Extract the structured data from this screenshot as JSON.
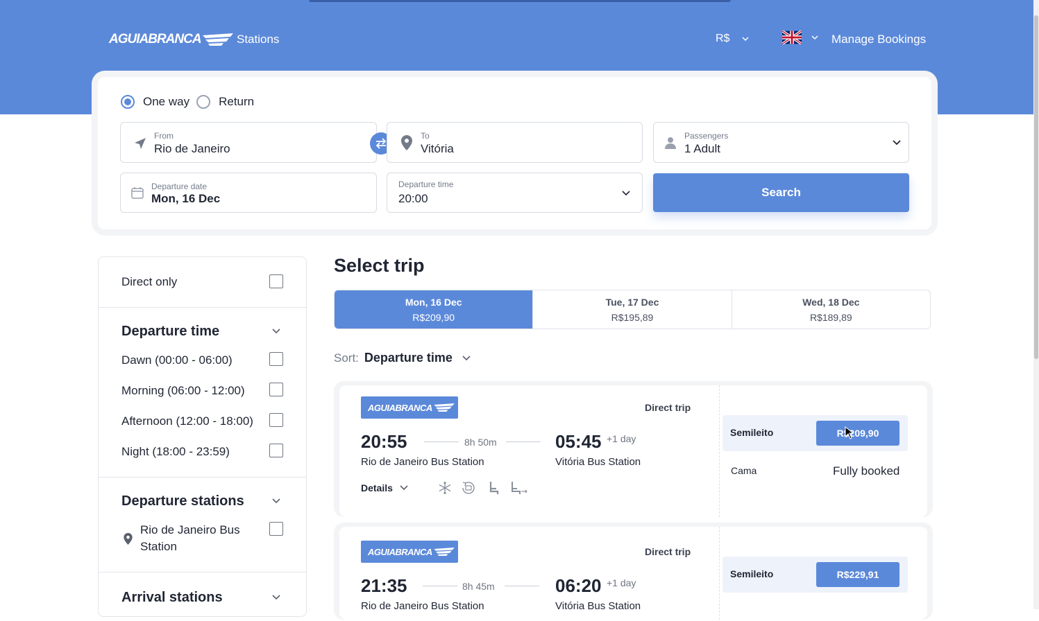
{
  "header": {
    "logo_text": "AGUIABRANCA",
    "stations_link": "Stations",
    "currency": "R$",
    "language_flag": "uk-flag-icon",
    "manage_bookings": "Manage Bookings"
  },
  "search": {
    "trip_types": [
      {
        "label": "One way",
        "selected": true
      },
      {
        "label": "Return",
        "selected": false
      }
    ],
    "from": {
      "label": "From",
      "value": "Rio de Janeiro"
    },
    "to": {
      "label": "To",
      "value": "Vitória"
    },
    "passengers": {
      "label": "Passengers",
      "value": "1 Adult"
    },
    "departure_date": {
      "label": "Departure date",
      "value": "Mon, 16 Dec"
    },
    "departure_time": {
      "label": "Departure time",
      "value": "20:00"
    },
    "search_button": "Search"
  },
  "filters": {
    "direct_only": "Direct only",
    "departure_time": {
      "title": "Departure time",
      "options": [
        "Dawn (00:00 - 06:00)",
        "Morning (06:00 - 12:00)",
        "Afternoon (12:00 - 18:00)",
        "Night (18:00 - 23:59)"
      ]
    },
    "departure_stations": {
      "title": "Departure stations",
      "options": [
        "Rio de Janeiro Bus Station"
      ]
    },
    "arrival_stations": {
      "title": "Arrival stations"
    }
  },
  "results": {
    "title": "Select trip",
    "date_tabs": [
      {
        "date": "Mon, 16 Dec",
        "price": "R$209,90",
        "active": true
      },
      {
        "date": "Tue, 17 Dec",
        "price": "R$195,89",
        "active": false
      },
      {
        "date": "Wed, 18 Dec",
        "price": "R$189,89",
        "active": false
      }
    ],
    "sort_label": "Sort:",
    "sort_value": "Departure time",
    "trips": [
      {
        "operator": "AGUIABRANCA",
        "type": "Direct trip",
        "dep_time": "20:55",
        "duration": "8h 50m",
        "arr_time": "05:45",
        "plus_day": "+1 day",
        "dep_station": "Rio de Janeiro Bus Station",
        "arr_station": "Vitória Bus Station",
        "details": "Details",
        "fares": [
          {
            "class": "Semileito",
            "price": "R$209,90"
          },
          {
            "class": "Cama",
            "status": "Fully booked"
          }
        ]
      },
      {
        "operator": "AGUIABRANCA",
        "type": "Direct trip",
        "dep_time": "21:35",
        "duration": "8h 45m",
        "arr_time": "06:20",
        "plus_day": "+1 day",
        "dep_station": "Rio de Janeiro Bus Station",
        "arr_station": "Vitória Bus Station",
        "fares": [
          {
            "class": "Semileito",
            "price": "R$229,91"
          }
        ]
      }
    ]
  },
  "colors": {
    "brand": "#5b89da",
    "text": "#1f2533"
  }
}
